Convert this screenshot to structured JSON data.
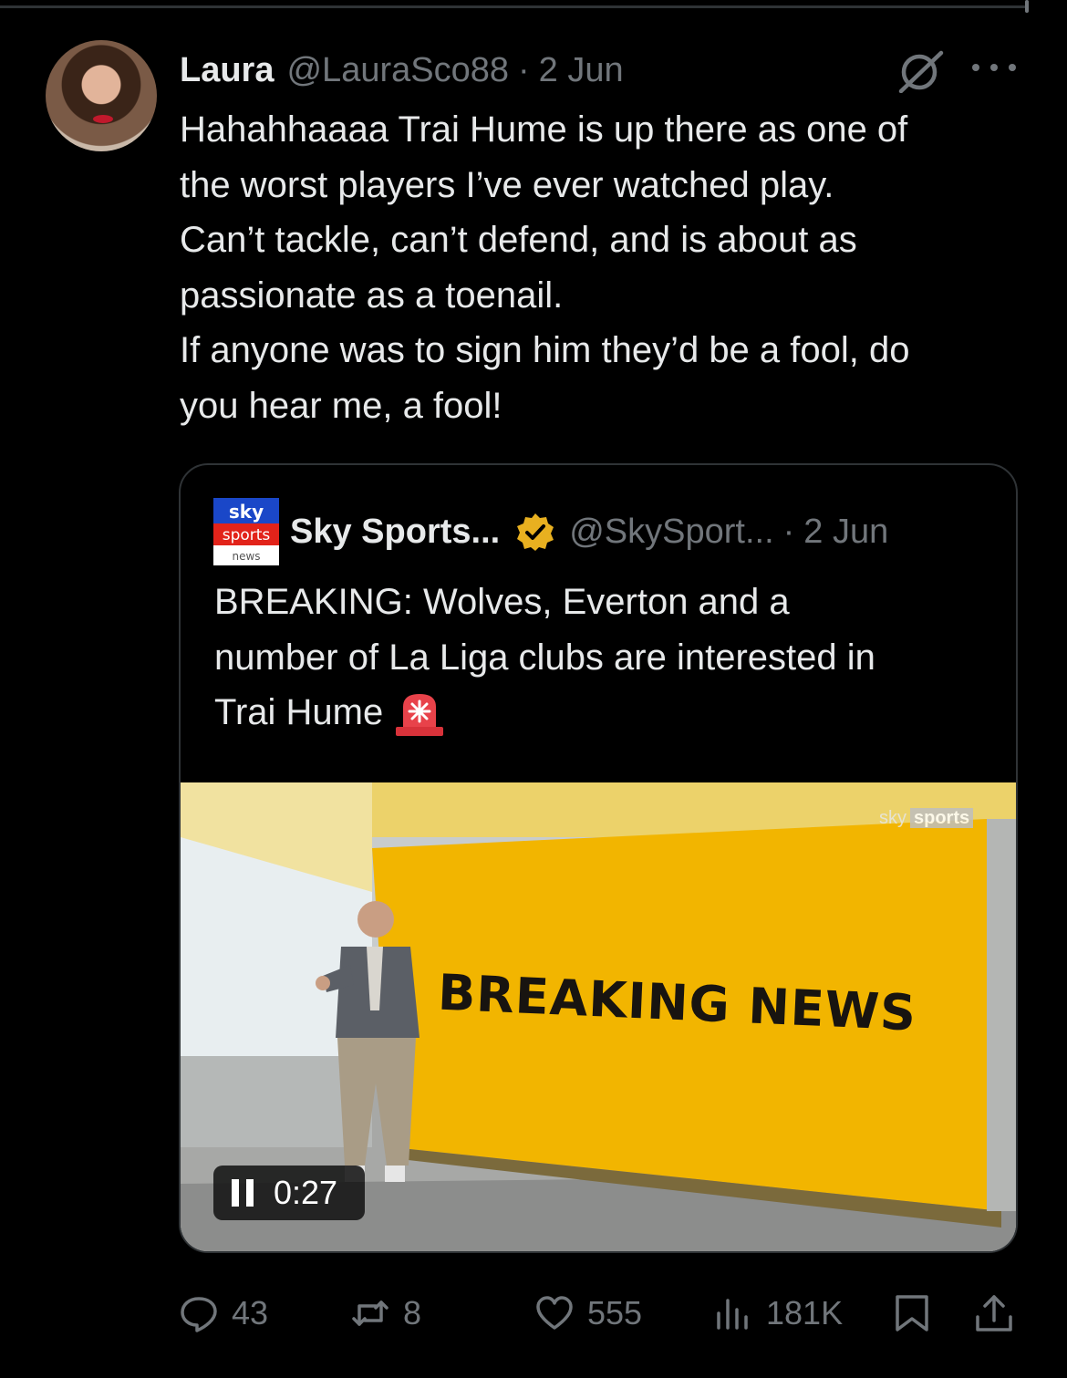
{
  "tweet": {
    "author_name": "Laura",
    "author_handle": "@LauraSco88",
    "separator": "·",
    "date": "2 Jun",
    "text_lines": [
      "Hahahhaaaa Trai Hume is up there as one of",
      "the worst players I’ve ever watched play.",
      "Can’t tackle, can’t defend, and is about as",
      "passionate as a toenail.",
      "If anyone was to sign him they’d be a fool, do",
      "you hear me, a fool!"
    ]
  },
  "quote": {
    "author_name": "Sky Sports...",
    "author_handle": "@SkySport...",
    "separator": "·",
    "date": "2 Jun",
    "logo_text": {
      "line1": "sky",
      "line2": "sports",
      "line3": "news"
    },
    "text_lines": [
      "BREAKING: Wolves, Everton and a",
      "number of La Liga clubs are interested in",
      "Trai Hume"
    ],
    "siren_icon": "police-light-emoji",
    "video": {
      "screen_text": "BREAKING NEWS",
      "watermark_left": "sky",
      "watermark_right": "sports",
      "time": "0:27",
      "state": "playing"
    }
  },
  "actions": {
    "replies": "43",
    "reposts": "8",
    "likes": "555",
    "views": "181K"
  },
  "colors": {
    "background": "#000000",
    "text": "#e7e9ea",
    "muted": "#71767b",
    "border": "#2f3336",
    "badge_gold": "#e8b020",
    "screen_yellow": "#f2b500"
  }
}
